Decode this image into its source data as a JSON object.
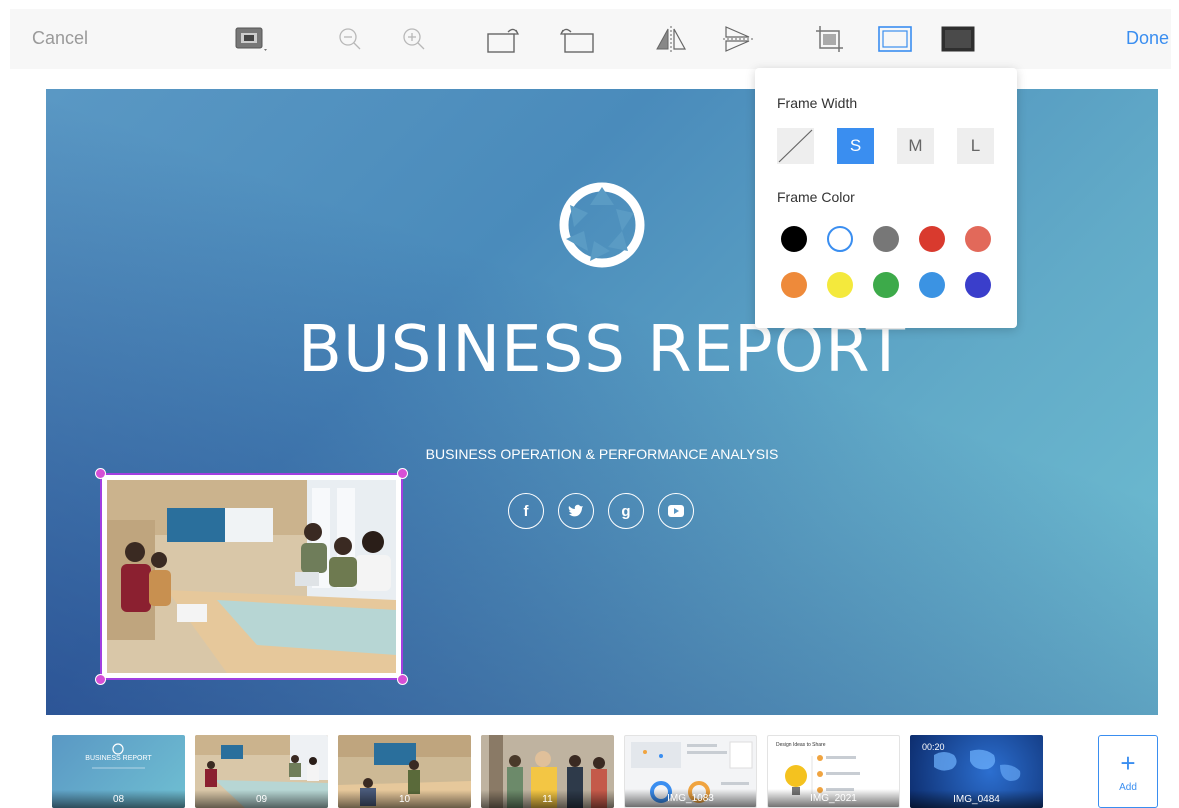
{
  "toolbar": {
    "cancel_label": "Cancel",
    "done_label": "Done",
    "tools": [
      "image-options-icon",
      "zoom-out-icon",
      "zoom-in-icon",
      "rotate-right-icon",
      "rotate-left-icon",
      "flip-horizontal-icon",
      "flip-vertical-icon",
      "crop-icon",
      "frame-icon",
      "fill-icon"
    ],
    "active_tool": "frame-icon"
  },
  "popover": {
    "width_heading": "Frame Width",
    "width_options": [
      "S",
      "M",
      "L"
    ],
    "selected_width": "S",
    "color_heading": "Frame Color",
    "colors": [
      "#000000",
      "#ffffff",
      "#777777",
      "#d93a2e",
      "#e2695a",
      "#ee8a3a",
      "#f4e93c",
      "#3daa4a",
      "#3b93e3",
      "#3a3ecb"
    ],
    "selected_color": "#ffffff"
  },
  "slide": {
    "title": "BUSINESS REPORT",
    "subtitle": "BUSINESS OPERATION & PERFORMANCE ANALYSIS",
    "social_icons": [
      "facebook-icon",
      "twitter-icon",
      "google-plus-icon",
      "youtube-icon"
    ]
  },
  "thumbnails": [
    {
      "label": "08",
      "preview_title": "BUSINESS REPORT"
    },
    {
      "label": "09"
    },
    {
      "label": "10"
    },
    {
      "label": "11"
    },
    {
      "label": "IMG_1083"
    },
    {
      "label": "IMG_2021",
      "preview_title": "Design Ideas to Share"
    },
    {
      "label": "IMG_0484",
      "duration": "00:20"
    }
  ],
  "add_label": "Add",
  "colors": {
    "accent": "#3a8ef0",
    "selection": "#a23fe0"
  }
}
